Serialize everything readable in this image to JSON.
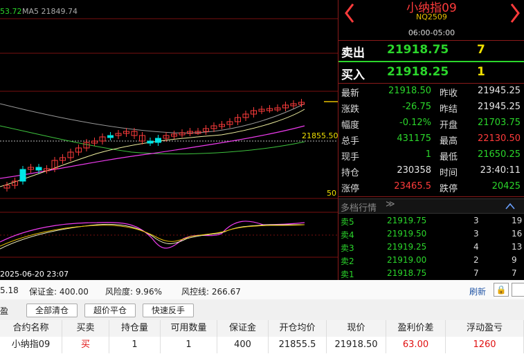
{
  "chart": {
    "ma_top_left": "53.72",
    "ma5_label": "MA5 21849.74",
    "price_tag": "21855.50",
    "axis_50": "50",
    "date_label": "2025-06-20 23:07"
  },
  "header": {
    "name": "小纳指09",
    "code": "NQ2509",
    "session": "06:00-05:00"
  },
  "orderbook": {
    "sell_label": "卖出",
    "sell_price": "21918.75",
    "sell_vol": "7",
    "buy_label": "买入",
    "buy_price": "21918.25",
    "buy_vol": "1"
  },
  "quote": [
    {
      "l1": "最新",
      "v1": "21918.50",
      "c1": "green",
      "l2": "昨收",
      "v2": "21945.25",
      "c2": "white"
    },
    {
      "l1": "涨跌",
      "v1": "-26.75",
      "c1": "green",
      "l2": "昨结",
      "v2": "21945.25",
      "c2": "white"
    },
    {
      "l1": "幅度",
      "v1": "-0.12%",
      "c1": "green",
      "l2": "开盘",
      "v2": "21703.75",
      "c2": "green"
    },
    {
      "l1": "总手",
      "v1": "431175",
      "c1": "green",
      "l2": "最高",
      "v2": "22130.50",
      "c2": "red"
    },
    {
      "l1": "现手",
      "v1": "1",
      "c1": "green",
      "l2": "最低",
      "v2": "21650.25",
      "c2": "green"
    },
    {
      "l1": "持仓",
      "v1": "230358",
      "c1": "white",
      "l2": "时间",
      "v2": "23:40:11",
      "c2": "white"
    },
    {
      "l1": "涨停",
      "v1": "23465.5",
      "c1": "red",
      "l2": "跌停",
      "v2": "20425",
      "c2": "green"
    }
  ],
  "depth": {
    "title": "多档行情",
    "rows": [
      {
        "label": "卖5",
        "price": "21919.75",
        "vol": "3",
        "extra": "19"
      },
      {
        "label": "卖4",
        "price": "21919.50",
        "vol": "3",
        "extra": "16"
      },
      {
        "label": "卖3",
        "price": "21919.25",
        "vol": "4",
        "extra": "13"
      },
      {
        "label": "卖2",
        "price": "21919.00",
        "vol": "2",
        "extra": "9"
      },
      {
        "label": "卖1",
        "price": "21918.75",
        "vol": "7",
        "extra": "7"
      }
    ]
  },
  "account": {
    "left_val": "5.18",
    "margin": "保证金: 400.00",
    "risk": "风险度: 9.96%",
    "control": "风控线: 266.67",
    "refresh": "刷新"
  },
  "buttons": {
    "tab_left": "盈",
    "close_all": "全部清仓",
    "market_close": "超价平仓",
    "reverse": "快速反手"
  },
  "table": {
    "headers": [
      "合约名称",
      "买卖",
      "持仓量",
      "可用数量",
      "保证金",
      "开仓均价",
      "现价",
      "盈利价差",
      "浮动盈亏"
    ],
    "row": [
      "小纳指09",
      "买",
      "1",
      "1",
      "400",
      "21855.5",
      "21918.50",
      "63.00",
      "1260"
    ]
  },
  "colors": {
    "up": "#ff3b3b",
    "down": "#2bd62b",
    "accent_border": "#8b1a1a"
  }
}
